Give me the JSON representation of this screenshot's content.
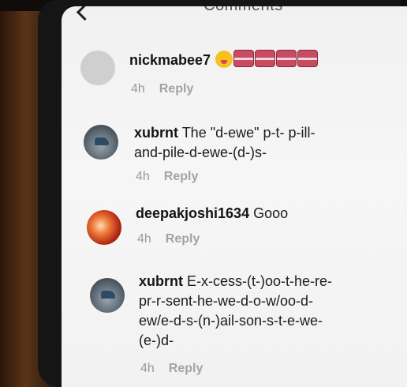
{
  "header": {
    "title": "Comments"
  },
  "comments": [
    {
      "username": "nickmabee7",
      "text": "",
      "time": "4h",
      "reply": "Reply"
    },
    {
      "username": "xubrnt",
      "text": "The \"d-ewe\" p-t- p-ill-",
      "text2": "and-pile-d-ewe-(d-)s-",
      "time": "4h",
      "reply": "Reply"
    },
    {
      "username": "deepakjoshi1634",
      "text": "Gooo",
      "time": "4h",
      "reply": "Reply"
    },
    {
      "username": "xubrnt",
      "text": "E-x-cess-(t-)oo-t-he-re-",
      "text2": "pr-r-sent-he-we-d-o-w/oo-d-",
      "text3": "ew/e-d-s-(n-)ail-son-s-t-e-we-",
      "text4": "(e-)d-",
      "time": "4h",
      "reply": "Reply"
    }
  ],
  "icons": {
    "back": "chevron-left-icon",
    "emoji_1": "face-with-tongue-icon",
    "emoji_2": "emoji-icon"
  }
}
